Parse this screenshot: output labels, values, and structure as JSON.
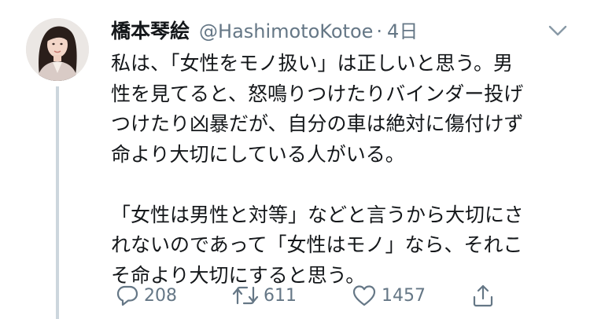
{
  "tweet": {
    "display_name": "橋本琴絵",
    "handle": "@HashimotoKotoe",
    "separator": "·",
    "time": "4日",
    "body_lines": [
      "私は、「女性をモノ扱い」は正しいと思う。男",
      "性を見てると、怒鳴りつけたりバインダー投げ",
      "つけたり凶暴だが、自分の車は絶対に傷付けず",
      "命より大切にしている人がいる。",
      "",
      "「女性は男性と対等」などと言うから大切にさ",
      "れないのであって「女性はモノ」なら、それこ",
      "そ命より大切にすると思う。"
    ],
    "actions": {
      "reply_count": "208",
      "retweet_count": "611",
      "like_count": "1457"
    },
    "colors": {
      "text": "#14171a",
      "secondary": "#657786",
      "thread_line": "#ccd6dd"
    },
    "icons": [
      "chevron-down-icon",
      "reply-icon",
      "retweet-icon",
      "like-icon",
      "share-icon"
    ]
  }
}
